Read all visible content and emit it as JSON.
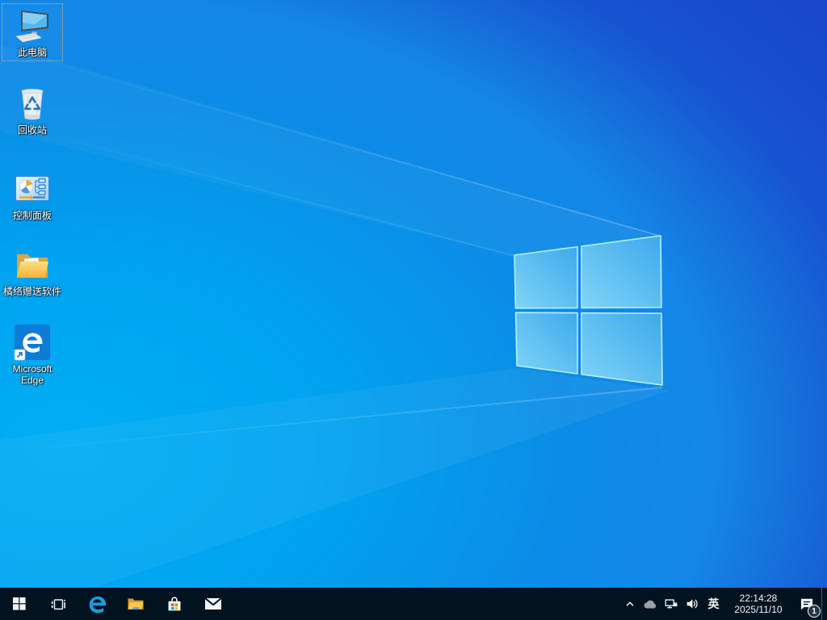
{
  "desktop": {
    "icons": [
      {
        "name": "this-pc",
        "label": "此电脑",
        "selected": true
      },
      {
        "name": "recycle-bin",
        "label": "回收站",
        "selected": false
      },
      {
        "name": "control-panel",
        "label": "控制面板",
        "selected": false
      },
      {
        "name": "gift-software-folder",
        "label": "橘络赠送软件",
        "selected": false
      },
      {
        "name": "microsoft-edge",
        "label": "Microsoft Edge",
        "selected": false
      }
    ]
  },
  "taskbar": {
    "buttons": [
      {
        "name": "start"
      },
      {
        "name": "task-view"
      },
      {
        "name": "microsoft-edge"
      },
      {
        "name": "file-explorer"
      },
      {
        "name": "microsoft-store"
      },
      {
        "name": "mail"
      }
    ],
    "tray": {
      "ime_label": "英",
      "clock": {
        "time": "22:14:28",
        "date": "2025/11/10"
      },
      "notification_badge": "1"
    }
  },
  "colors": {
    "taskbar_background": "#02131f",
    "wallpaper_bright": "#00a8f0",
    "wallpaper_dark": "#1845c5",
    "logo_pane": "#54bdf0",
    "logo_edge": "#b4f1ff",
    "accent_blue": "#0078d7",
    "store_red": "#f25022",
    "store_green": "#7fba00",
    "store_blue": "#00a4ef",
    "store_yellow": "#ffb900"
  }
}
